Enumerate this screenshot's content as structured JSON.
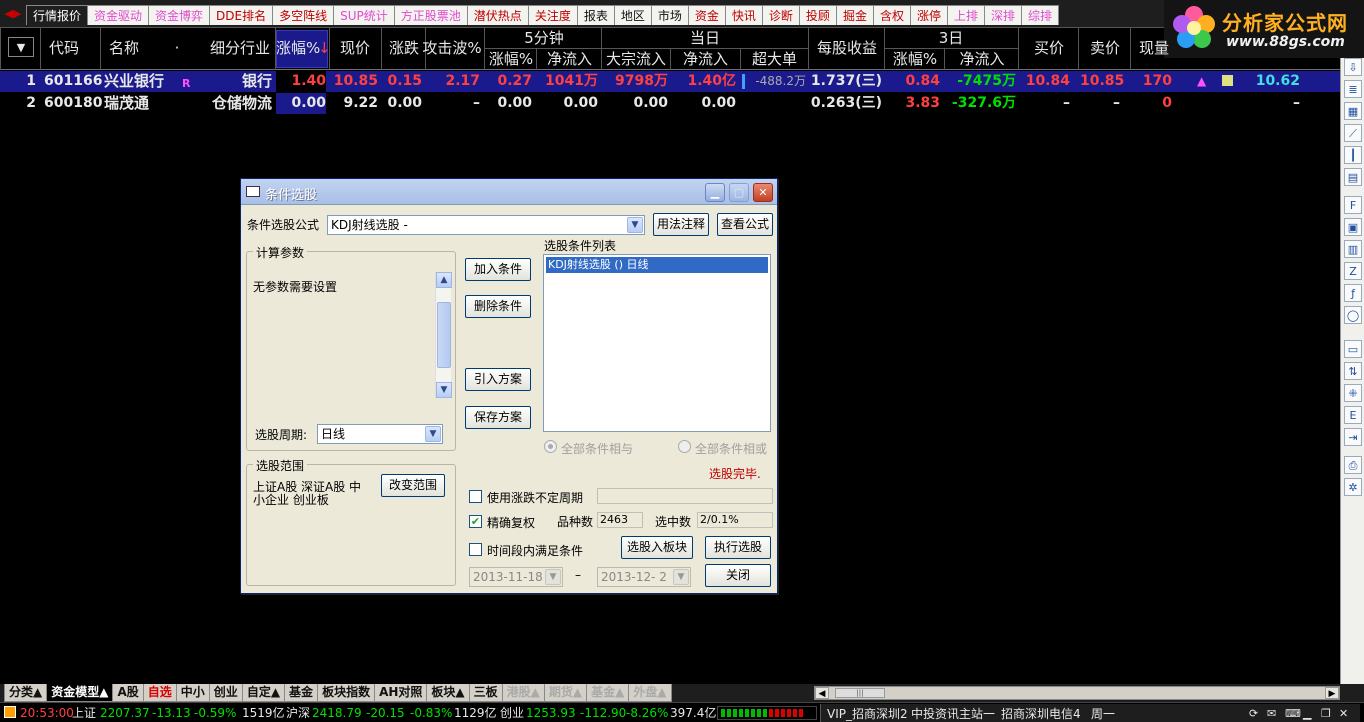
{
  "top_tabs": [
    {
      "label": "行情报价",
      "active": true,
      "color": "active"
    },
    {
      "label": "资金驱动",
      "color": "pink"
    },
    {
      "label": "资金博弈",
      "color": "pink"
    },
    {
      "label": "DDE排名",
      "color": "red"
    },
    {
      "label": "多空阵线",
      "color": "red"
    },
    {
      "label": "SUP统计",
      "color": "pink"
    },
    {
      "label": "方正股票池",
      "color": "pink"
    },
    {
      "label": "潜伏热点",
      "color": "red"
    },
    {
      "label": "关注度",
      "color": "red"
    },
    {
      "label": "报表",
      "color": "dark"
    },
    {
      "label": "地区",
      "color": "dark"
    },
    {
      "label": "市场",
      "color": "dark"
    },
    {
      "label": "资金",
      "color": "red"
    },
    {
      "label": "快讯",
      "color": "red"
    },
    {
      "label": "诊断",
      "color": "red"
    },
    {
      "label": "投顾",
      "color": "red"
    },
    {
      "label": "掘金",
      "color": "red"
    },
    {
      "label": "含权",
      "color": "red"
    },
    {
      "label": "涨停",
      "color": "red"
    },
    {
      "label": "上排",
      "color": "pink"
    },
    {
      "label": "深排",
      "color": "pink"
    },
    {
      "label": "综排",
      "color": "pink"
    }
  ],
  "logo": {
    "title": "分析家公式网",
    "url": "www.88gs.com"
  },
  "header": {
    "menu_btn": "▼",
    "code": "代码",
    "name": "名称",
    "dot": "·",
    "industry": "细分行业",
    "change_pct": "涨幅%",
    "sort_arrow": "↓",
    "price": "现价",
    "change": "涨跌",
    "attack": "攻击波%",
    "group_5min": "5分钟",
    "group_today": "当日",
    "group_3day": "3日",
    "min5_pct": "涨幅%",
    "min5_net": "净流入",
    "block_in": "大宗流入",
    "today_net": "净流入",
    "super_big": "超大单",
    "eps": "每股收益",
    "day3_pct": "涨幅%",
    "day3_net": "净流入",
    "buy": "买价",
    "sell": "卖价",
    "volume": "现量"
  },
  "rows": [
    {
      "idx": "1",
      "code": "601166",
      "name": "兴业银行",
      "flag": "R",
      "industry": "银行",
      "change_pct": "1.40",
      "price": "10.85",
      "change": "0.15",
      "attack": "2.17",
      "min5_pct": "0.27",
      "min5_net": "1041万",
      "block_in": "9798万",
      "today_net": "1.40亿",
      "super_big": "-488.2万",
      "eps": "1.737(三)",
      "day3_pct": "0.84",
      "day3_net": "-7475万",
      "buy": "10.84",
      "sell": "10.85",
      "volume": "170",
      "last": "10.62"
    },
    {
      "idx": "2",
      "code": "600180",
      "name": "瑞茂通",
      "flag": "",
      "industry": "仓储物流",
      "change_pct": "0.00",
      "price": "9.22",
      "change": "0.00",
      "attack": "–",
      "min5_pct": "0.00",
      "min5_net": "0.00",
      "block_in": "0.00",
      "today_net": "0.00",
      "super_big": "",
      "eps": "0.263(三)",
      "day3_pct": "3.83",
      "day3_net": "-327.6万",
      "buy": "–",
      "sell": "–",
      "volume": "0",
      "last": "–"
    }
  ],
  "dialog": {
    "title": "条件选股",
    "formula_label": "条件选股公式",
    "formula_value": "KDJ射线选股 -",
    "btn_usage": "用法注释",
    "btn_view": "查看公式",
    "params_group": "计算参数",
    "params_text": "无参数需要设置",
    "period_label": "选股周期:",
    "period_value": "日线",
    "btn_add": "加入条件",
    "btn_delete": "删除条件",
    "btn_import": "引入方案",
    "btn_save": "保存方案",
    "list_title": "选股条件列表",
    "list_item": "KDJ射线选股  () 日线",
    "radio_and": "全部条件相与",
    "radio_or": "全部条件相或",
    "status": "选股完毕.",
    "range_group": "选股范围",
    "range_text_1": "上证A股 深证A股 中",
    "range_text_2": "小企业 创业板",
    "btn_change_range": "改变范围",
    "chk_uncertain": "使用涨跌不定周期",
    "chk_exact": "精确复权",
    "count_label": "品种数",
    "count_value": "2463",
    "selected_label": "选中数",
    "selected_value": "2/0.1%",
    "chk_time": "时间段内满足条件",
    "btn_to_block": "选股入板块",
    "btn_execute": "执行选股",
    "date_from": "2013-11-18",
    "date_sep": "–",
    "date_to": "2013-12- 2",
    "btn_close": "关闭"
  },
  "bottom_tabs": [
    {
      "label": "分类▲",
      "color": "dark"
    },
    {
      "label": "资金模型▲",
      "color": "active"
    },
    {
      "label": "A股",
      "color": "dark"
    },
    {
      "label": "自选",
      "color": "red"
    },
    {
      "label": "中小",
      "color": "dark"
    },
    {
      "label": "创业",
      "color": "dark"
    },
    {
      "label": "自定▲",
      "color": "dark"
    },
    {
      "label": "基金",
      "color": "dark"
    },
    {
      "label": "板块指数",
      "color": "dark"
    },
    {
      "label": "AH对照",
      "color": "dark"
    },
    {
      "label": "板块▲",
      "color": "dark"
    },
    {
      "label": "三板",
      "color": "dark"
    },
    {
      "label": "港股▲",
      "color": "gray"
    },
    {
      "label": "期货▲",
      "color": "gray"
    },
    {
      "label": "基金▲",
      "color": "gray"
    },
    {
      "label": "外盘▲",
      "color": "gray"
    }
  ],
  "status": {
    "time": "20:53:00",
    "sh_label": "上证",
    "sh_index": "2207.37",
    "sh_change": "-13.13",
    "sh_pct": "-0.59%",
    "sh_amount": "1519亿",
    "hs_label": "沪深",
    "hs_index": "2418.79",
    "hs_change": "-20.15",
    "hs_pct": "-0.83%",
    "hs_amount": "1129亿",
    "cy_label": "创业",
    "cy_index": "1253.93",
    "cy_change": "-112.90",
    "cy_pct": "-8.26%",
    "cy_amount": "397.4亿",
    "vip": "VIP_招商深圳2",
    "station": "中投资讯主站一",
    "telecom": "招商深圳电信4",
    "weekday": "周一"
  },
  "colors": {
    "up": "#ff4040",
    "down": "#00e000",
    "highlight_row": "#1a1a8c",
    "dialog_bg": "#ece9d8"
  }
}
